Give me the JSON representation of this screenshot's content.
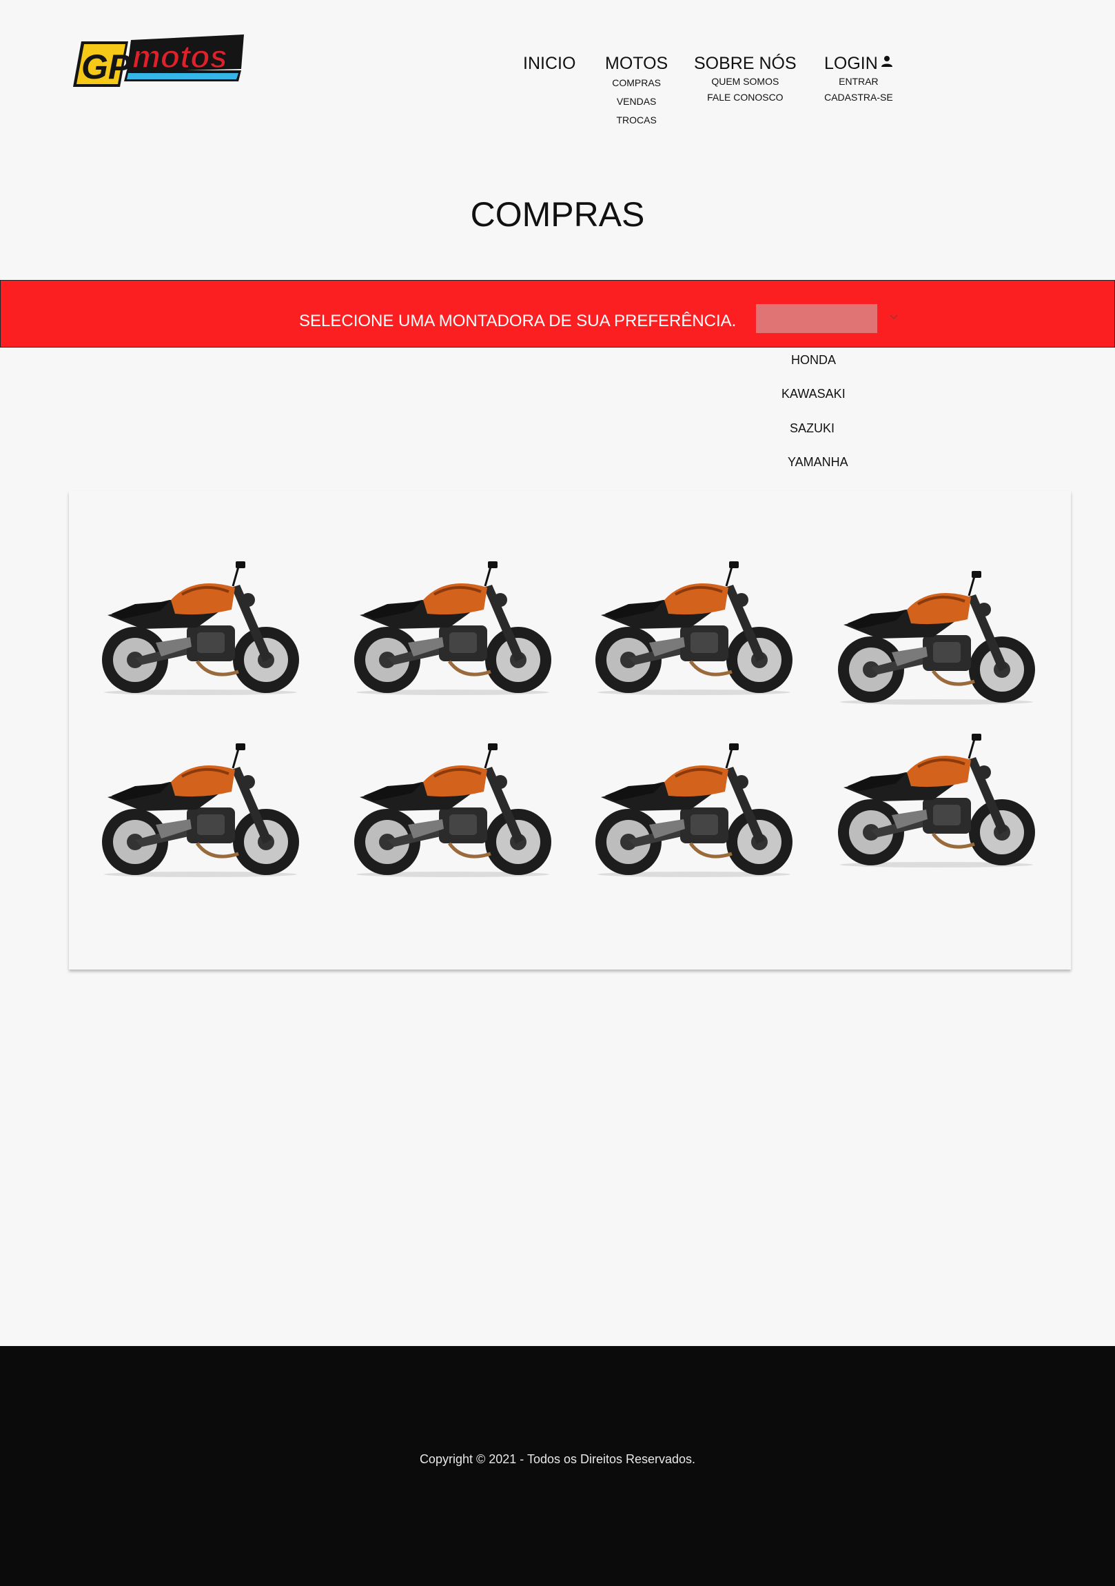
{
  "brand": {
    "logo_gp": "GP",
    "logo_motos": "motos",
    "colors": {
      "yellow": "#f6c818",
      "red": "#e0202a",
      "blue": "#36b6e8",
      "dark": "#151515"
    }
  },
  "nav": {
    "inicio": "INICIO",
    "motos": {
      "label": "MOTOS",
      "items": [
        "COMPRAS",
        "VENDAS",
        "TROCAS"
      ]
    },
    "sobre": {
      "label": "SOBRE NÓS",
      "items": [
        "QUEM SOMOS",
        "FALE CONOSCO"
      ]
    },
    "login": {
      "label": "LOGIN",
      "icon": "user-icon",
      "items": [
        "ENTRAR",
        "CADASTRA-SE"
      ]
    }
  },
  "page_title": "COMPRAS",
  "filter": {
    "prompt": "SELECIONE UMA MONTADORA DE SUA PREFERÊNCIA.",
    "selected": "",
    "icon": "chevron-down-icon",
    "options": [
      "HONDA",
      "KAWASAKI",
      "SAZUKI",
      "YAMANHA"
    ],
    "bar_color": "#fc1f22"
  },
  "gallery": {
    "item_count": 8,
    "bike_colors": {
      "tank": "#d2621c",
      "frame": "#1d1d1d"
    }
  },
  "footer": {
    "copyright": "Copyright © 2021 - Todos os Direitos Reservados."
  }
}
